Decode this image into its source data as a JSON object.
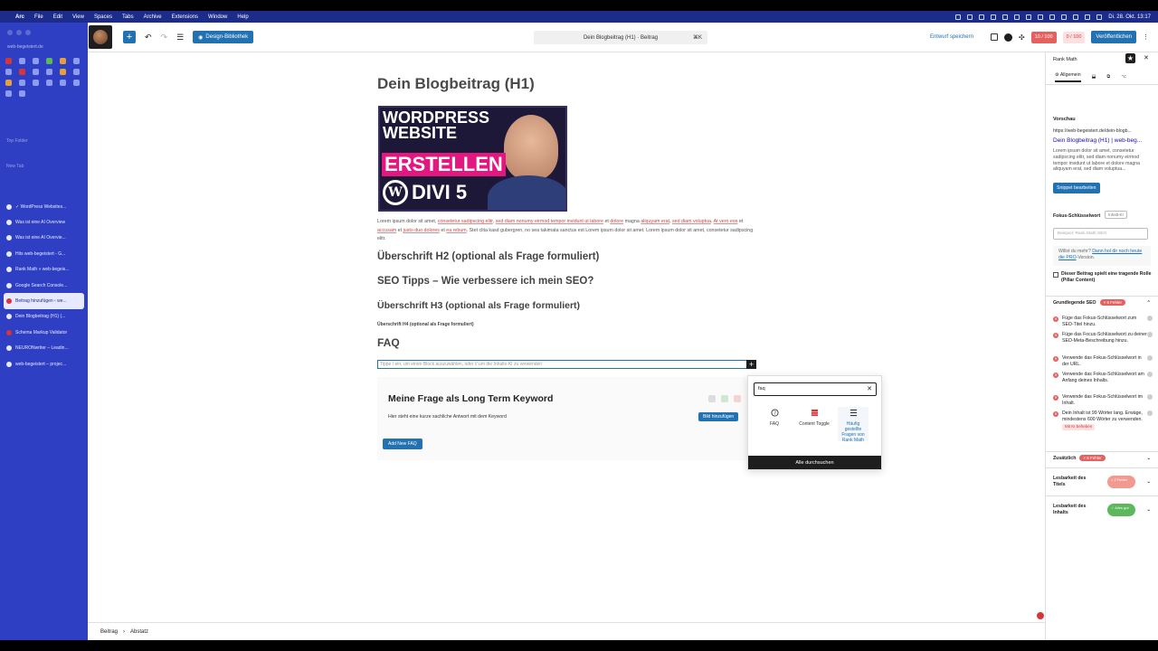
{
  "menubar": {
    "items": [
      "Arc",
      "File",
      "Edit",
      "View",
      "Spaces",
      "Tabs",
      "Archive",
      "Extensions",
      "Window",
      "Help"
    ],
    "clock": "Di. 28. Okt. 13:17"
  },
  "arc": {
    "url": "web-begeistert.de",
    "section_favorites": "Top Folder",
    "section_tabs": "New Tab",
    "tabs": [
      "✓ WordPress Websites...",
      "Was ist eine AI Overview",
      "Was ist eine AI Overvie...",
      "Hits web-begeistert - G...",
      "Rank Math » web-begeis...",
      "Google Search Console...",
      "Beitrag hinzufügen ‹ we...",
      "Dein Blogbeitrag (H1) (...",
      "Schema Markup Validator",
      "NEURONwriter – Leadin...",
      "web-begeistert – projec..."
    ],
    "active_index": 6
  },
  "topbar": {
    "design_library": "Design-Bibliothek",
    "doc_title": "Dein Blogbeitrag (H1) · Beitrag",
    "shortcut": "⌘K",
    "save_draft": "Entwurf speichern",
    "score_seo": "10 / 100",
    "score_content": "0 / 100",
    "publish": "Veröffentlichen"
  },
  "content": {
    "h1": "Dein Blogbeitrag (H1)",
    "thumbnail": {
      "line1": "WORDPRESS",
      "line2": "WEBSITE",
      "line3": "ERSTELLEN",
      "line4": "DIVI 5"
    },
    "lorem_parts": [
      {
        "text": "Lorem ipsum dolor sit amet, ",
        "u": false
      },
      {
        "text": "consetetur sadipscing elitr",
        "u": true
      },
      {
        "text": ", ",
        "u": false
      },
      {
        "text": "sed diam nonumy eirmod tempor invidunt ut labore",
        "u": true
      },
      {
        "text": " et ",
        "u": false
      },
      {
        "text": "dolore",
        "u": true
      },
      {
        "text": " magna ",
        "u": false
      },
      {
        "text": "aliquyam erat",
        "u": true
      },
      {
        "text": ", ",
        "u": false
      },
      {
        "text": "sed diam voluptua",
        "u": true
      },
      {
        "text": ". ",
        "u": false
      },
      {
        "text": "At vero eos",
        "u": true
      },
      {
        "text": " et ",
        "u": false
      },
      {
        "text": "accusam",
        "u": true
      },
      {
        "text": " et ",
        "u": false
      },
      {
        "text": "justo duo dolores",
        "u": true
      },
      {
        "text": " et ",
        "u": false
      },
      {
        "text": "ea rebum",
        "u": true
      },
      {
        "text": ". Stet clita kasd gubergren, no sea takimata sanctus est Lorem ipsum dolor sit amet. Lorem ipsum dolor sit amet, consetetur sadipscing elitr.",
        "u": false
      }
    ],
    "h2a": "Überschrift H2 (optional als Frage formuliert)",
    "h2b": "SEO Tipps – Wie verbessere ich mein SEO?",
    "h3": "Überschrift H3 (optional als Frage formuliert)",
    "h4": "Überschrift H4 (optional als Frage formuliert)",
    "faq_heading": "FAQ",
    "paragraph_placeholder": "Tippe / ein, um einen Block auszuwählen, oder // um die Inhalts-KI zu verwenden"
  },
  "faq_block": {
    "question": "Meine Frage als Long Term Keyword",
    "answer": "Hier steht eine kurze sachliche Antwort mit dem Keyword",
    "add_image": "Bild hinzufügen",
    "add_faq": "Add New FAQ"
  },
  "inserter": {
    "search_value": "faq",
    "results": [
      {
        "label": "FAQ",
        "icon": "question-circle-icon"
      },
      {
        "label": "Content Toggle",
        "icon": "toggle-icon"
      },
      {
        "label": "Häufig gestellte Fragen von Rank Math",
        "icon": "list-icon"
      }
    ],
    "browse_all": "Alle durchsuchen"
  },
  "breadcrumb": [
    "Beitrag",
    "Abstatz"
  ],
  "rankmath": {
    "title": "Rank Math",
    "tab_general": "Allgemein",
    "preview_label": "Vorschau",
    "preview_url": "https://web-begeistert.de/dein-blogb...",
    "preview_title": "Dein Blogbeitrag (H1) | web-beg...",
    "preview_desc": "Lorem ipsum dolor sit amet, consetetur sadipscing elitr, sed diam nonumy eirmod tempor invidunt ut labore et dolore magna aliquyam erat, sed diam voluptua...",
    "edit_snippet": "Snippet bearbeiten",
    "focus_kw_label": "Fokus-Schlüsselwort",
    "focus_kw_btn": "Inhalt-KI",
    "focus_kw_placeholder": "Beispiel: Rank Math SEO",
    "promo_text": "Willst du mehr? ",
    "promo_link": "Dann hol dir noch heute die PRO",
    "promo_tail": "-Version.",
    "pillar": "Dieser Beitrag spielt eine tragende Rolle (Pillar Content)",
    "basic_seo": "Grundlegende SEO",
    "basic_seo_err": "× 6 Fehler",
    "checks": [
      "Füge das Fokus-Schlüsselwort zum SEO-Titel hinzu.",
      "Füge das Focus-Schlüsselwort zu deiner SEO-Meta-Beschreibung hinzu.",
      "Verwende das Fokus-Schlüsselwort in der URL.",
      "Verwende das Fokus-Schlüsselwort am Anfang deines Inhalts.",
      "Verwende das Fokus-Schlüsselwort im Inhalt.",
      "Dein Inhalt ist 99 Wörter lang. Erwäge, mindestens 600 Wörter zu verwenden."
    ],
    "ai_fix": "Mit KI beheben",
    "additional": "Zusätzlich",
    "additional_err": "× 6 Fehler",
    "title_readability": "Lesbarkeit des Titels",
    "title_readability_badge": "× 2 Fehler",
    "content_readability": "Lesbarkeit des Inhalts",
    "content_readability_badge": "✓ Alles gut"
  },
  "colors": {
    "arc_sidebar": "#2e3fc4",
    "wp_blue": "#2271b1",
    "error_red": "#e56160"
  }
}
